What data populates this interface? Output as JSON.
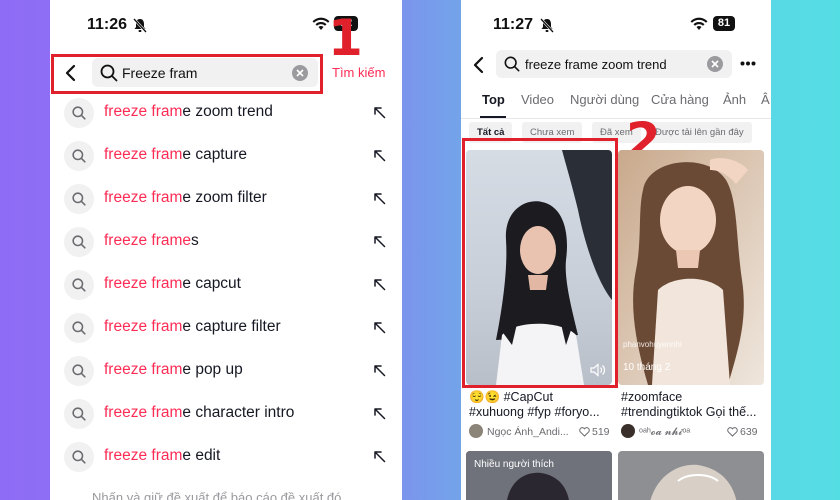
{
  "left_phone": {
    "time": "11:26",
    "battery": "82",
    "search_value": "Freeze fram",
    "search_button": "Tìm kiếm",
    "annotation": "1",
    "suggestions": [
      {
        "highlight": "freeze fram",
        "rest": "e zoom trend"
      },
      {
        "highlight": "freeze fram",
        "rest": "e capture"
      },
      {
        "highlight": "freeze fram",
        "rest": "e zoom filter"
      },
      {
        "highlight": "freeze frame",
        "rest": "s"
      },
      {
        "highlight": "freeze fram",
        "rest": "e capcut"
      },
      {
        "highlight": "freeze fram",
        "rest": "e capture filter"
      },
      {
        "highlight": "freeze fram",
        "rest": "e pop up"
      },
      {
        "highlight": "freeze fram",
        "rest": "e character intro"
      },
      {
        "highlight": "freeze fram",
        "rest": "e edit"
      }
    ],
    "footer": "Nhấn và giữ đề xuất để báo cáo đề xuất đó"
  },
  "right_phone": {
    "time": "11:27",
    "battery": "81",
    "search_value": "freeze frame zoom trend",
    "annotation": "2",
    "tabs": [
      "Top",
      "Video",
      "Người dùng",
      "Cửa hàng",
      "Ảnh",
      "Â"
    ],
    "filters": [
      "Tất cả",
      "Chưa xem",
      "Đã xem",
      "Được tải lên gần đây"
    ],
    "cards": [
      {
        "caption_line1": "😌😉 #CapCut",
        "caption_line2": "#xuhuong #fyp #foryo...",
        "author": "Ngọc Ánh_Andi...",
        "likes": "519"
      },
      {
        "overlay_handle": "phanvohuyennhi",
        "overlay_date": "10 tháng 2",
        "caption_line1": "#zoomface",
        "caption_line2": "#trendingtiktok Gọi thế...",
        "author": "ᵒᵃʰ𝓸𝓪 𝓷𝓱𝓲ᵒᵃ",
        "likes": "639"
      },
      {
        "badge": "Nhiều người thích"
      }
    ]
  },
  "colors": {
    "highlight": "#fe2c55",
    "annotation_red": "#e0212b"
  },
  "icons": [
    "bell-slash-icon",
    "wifi-icon",
    "battery-icon",
    "back-chevron-icon",
    "search-icon",
    "clear-icon",
    "north-west-arrow-icon",
    "more-dots-icon",
    "speaker-icon",
    "heart-icon"
  ]
}
